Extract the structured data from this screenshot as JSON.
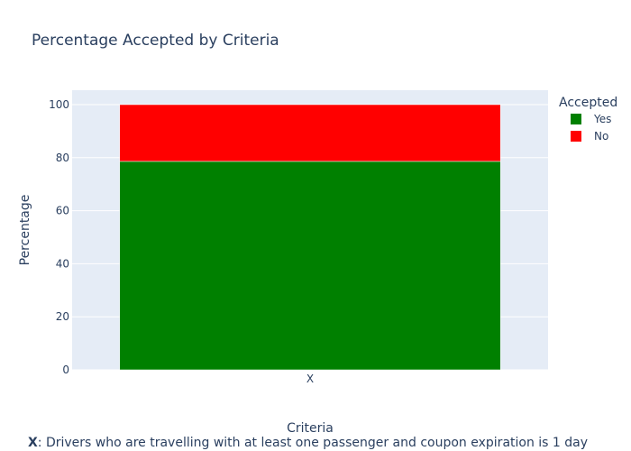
{
  "chart_data": {
    "type": "bar",
    "stacked": true,
    "title": "Percentage Accepted by Criteria",
    "xlabel": "Criteria",
    "ylabel": "Percentage",
    "categories": [
      "X"
    ],
    "ylim": [
      0,
      100
    ],
    "yticks": [
      0,
      20,
      40,
      60,
      80,
      100
    ],
    "grid": true,
    "legend": {
      "title": "Accepted",
      "placement": "top-right"
    },
    "series": [
      {
        "name": "Yes",
        "values": [
          78.6
        ],
        "color": "#008000"
      },
      {
        "name": "No",
        "values": [
          21.4
        ],
        "color": "#ff0000"
      }
    ],
    "plot_background": "#e5ecf6"
  },
  "footnote": {
    "key": "X",
    "text": ": Drivers who are travelling with at least one passenger and coupon expiration is 1 day"
  }
}
